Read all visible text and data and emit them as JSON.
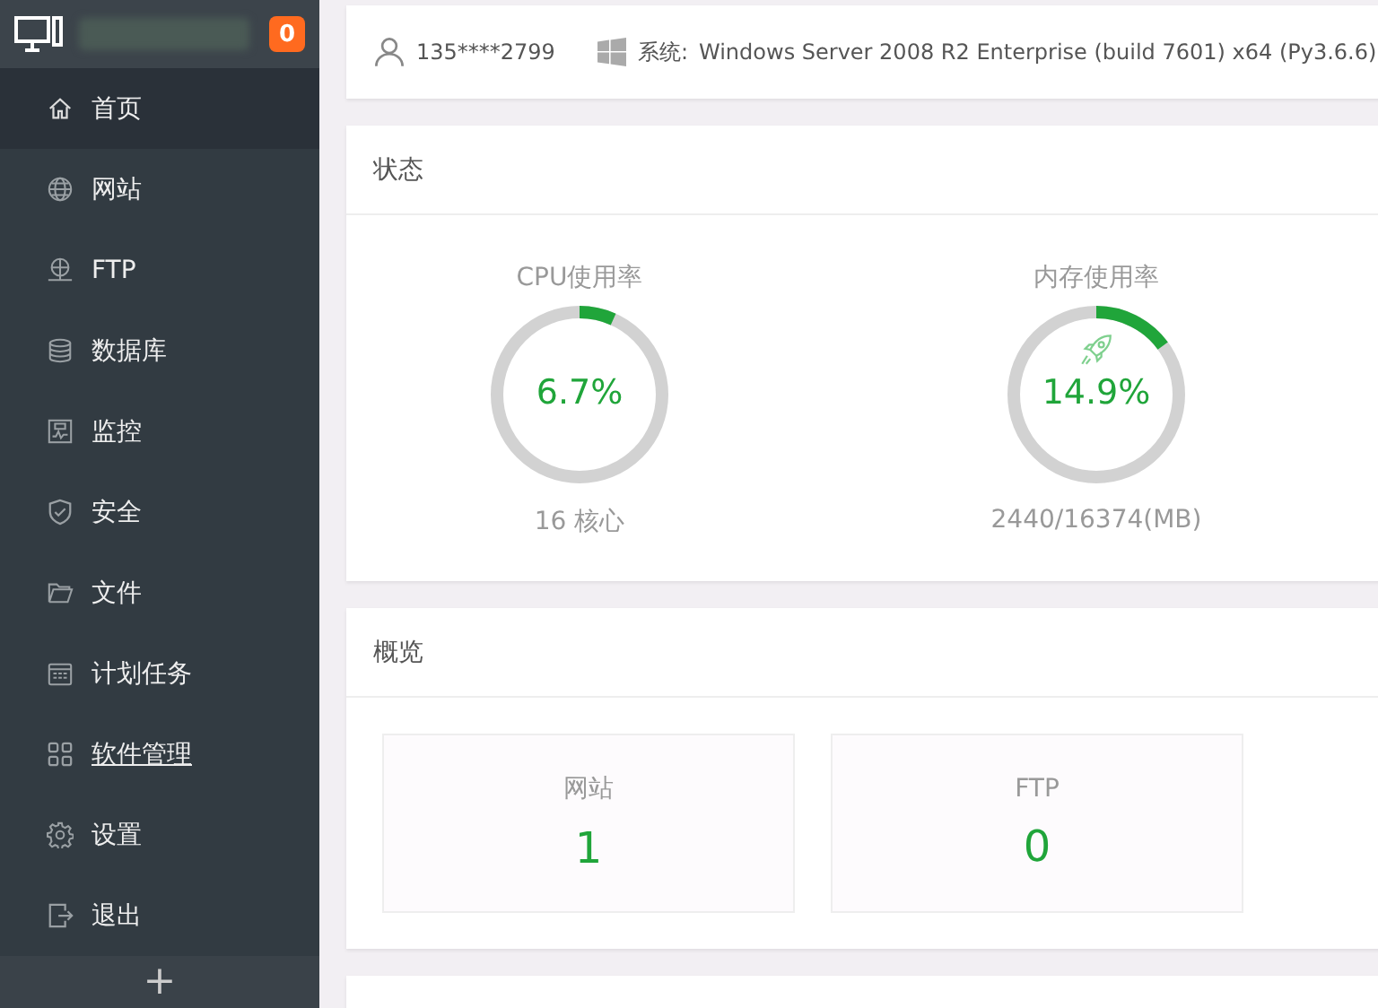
{
  "sidebar": {
    "badge": "0",
    "items": [
      {
        "label": "首页",
        "selected": true,
        "hovered": false
      },
      {
        "label": "网站",
        "selected": false,
        "hovered": false
      },
      {
        "label": "FTP",
        "selected": false,
        "hovered": false
      },
      {
        "label": "数据库",
        "selected": false,
        "hovered": false
      },
      {
        "label": "监控",
        "selected": false,
        "hovered": false
      },
      {
        "label": "安全",
        "selected": false,
        "hovered": false
      },
      {
        "label": "文件",
        "selected": false,
        "hovered": false
      },
      {
        "label": "计划任务",
        "selected": false,
        "hovered": false
      },
      {
        "label": "软件管理",
        "selected": false,
        "hovered": true
      },
      {
        "label": "设置",
        "selected": false,
        "hovered": false
      },
      {
        "label": "退出",
        "selected": false,
        "hovered": false
      }
    ],
    "add_button": "+"
  },
  "topbar": {
    "user": "135****2799",
    "system_label": "系统:",
    "system": "Windows Server 2008 R2 Enterprise (build 7601) x64 (Py3.6.6)"
  },
  "status": {
    "title": "状态",
    "gauges": [
      {
        "title": "CPU使用率",
        "value": "6.7%",
        "level": 0.067,
        "detail": "16 核心"
      },
      {
        "title": "内存使用率",
        "value": "14.9%",
        "level": 0.149,
        "detail": "2440/16374(MB)"
      }
    ]
  },
  "overview": {
    "title": "概览",
    "tiles": [
      {
        "label": "网站",
        "count": "1"
      },
      {
        "label": "FTP",
        "count": "0"
      }
    ]
  }
}
